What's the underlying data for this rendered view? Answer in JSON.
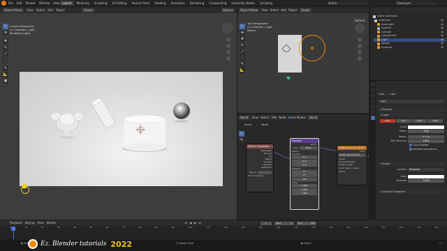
{
  "topbar": {
    "menus": [
      "File",
      "Edit",
      "Render",
      "Window",
      "Help"
    ],
    "workspace_tabs": [
      "Layout",
      "Modeling",
      "Sculpting",
      "UV Editing",
      "Texture Paint",
      "Shading",
      "Animation",
      "Rendering",
      "Compositing",
      "Geometry Nodes",
      "Scripting"
    ],
    "active_tab": "Layout",
    "scene_name": "Scene",
    "view_layer": "ViewLayer"
  },
  "viewport_left": {
    "mode": "Object Mode",
    "menus": [
      "View",
      "Select",
      "Add",
      "Object"
    ],
    "transform": "Global",
    "info_line1": "Camera Perspective",
    "info_line2": "(1) Collection | Light",
    "info_line3": "Rendering Lights",
    "options_label": "Options"
  },
  "viewport_right": {
    "mode": "Object Mode",
    "menus": [
      "View",
      "Select",
      "Add",
      "Object"
    ],
    "transform": "Global",
    "info_line1": "Top Orthographic",
    "info_line2": "(1) Collection | Light",
    "info_line3": "Meters",
    "options_label": "Options"
  },
  "node_editor": {
    "world_label": "World",
    "menus": [
      "View",
      "Select",
      "Add",
      "Node"
    ],
    "use_nodes_label": "Use Nodes",
    "slot_label": "World",
    "breadcrumb": [
      "Scene",
      "World"
    ],
    "nodes": {
      "texcoord": {
        "title": "Texture Coordinate",
        "outputs": [
          "Generated",
          "Normal",
          "UV",
          "Object",
          "Camera",
          "Window",
          "Reflection"
        ],
        "object_label": "Object",
        "from_instancer": "From Instancer"
      },
      "mapping": {
        "title": "Mapping",
        "outputs": [
          "Vector"
        ],
        "type_label": "Type",
        "type_value": "Point",
        "inputs": [
          "Vector",
          "Location"
        ],
        "loc_vals": [
          "0 m",
          "0 m",
          "0 m"
        ],
        "rotation_label": "Rotation",
        "rot_vals": [
          "0°",
          "0°",
          "-90°"
        ],
        "scale_label": "Scale",
        "scale_vals": [
          "1.000",
          "1.000",
          "1.000"
        ]
      },
      "envtex": {
        "title": "studio_small_03_4k.exr",
        "outputs": [
          "Color"
        ],
        "file": "studio_small_03_4k",
        "linear": "Linear",
        "projection": "Equirectangular",
        "extension": "Single Image",
        "colorspace_label": "Color Space",
        "colorspace_value": "Linear",
        "vector_label": "Vector"
      }
    }
  },
  "outliner": {
    "header_label": "Scene Collection",
    "items": [
      {
        "name": "Collection",
        "color": "#cccccc"
      },
      {
        "name": "Area.Light",
        "color": "#e3a13b"
      },
      {
        "name": "Camera",
        "color": "#9fb8d6"
      },
      {
        "name": "Cylinder",
        "color": "#e3a13b"
      },
      {
        "name": "Cylinder.001",
        "color": "#e3a13b"
      },
      {
        "name": "Light",
        "color": "#e3a13b"
      },
      {
        "name": "Sphere",
        "color": "#e3a13b"
      },
      {
        "name": "Suzanne",
        "color": "#e3a13b"
      }
    ],
    "selected_index": 5
  },
  "properties": {
    "breadcrumb": [
      "Light",
      "Light"
    ],
    "name_field": "Light",
    "preview_label": "Preview",
    "section_light": "Light",
    "light_types": [
      "Point",
      "Sun",
      "Spot",
      "Area"
    ],
    "active_type": "Point",
    "color_label": "Color",
    "power_label": "Power",
    "power_value": "0 W",
    "radius_label": "Radius",
    "radius_value": "0.1 m",
    "max_bounces_label": "Max Bounces",
    "max_bounces_value": "1024",
    "cast_shadow": "Cast Shadow",
    "multiple_importance": "Multiple Importance",
    "nodes_section": "Nodes",
    "surface_label": "Surface",
    "surface_value": "Emission",
    "node_color_label": "Color",
    "strength_label": "Strength",
    "strength_value": "1.000",
    "custom_props": "Custom Properties"
  },
  "timeline": {
    "playback": "Playback",
    "keying": "Keying",
    "menus": [
      "View",
      "Marker"
    ],
    "current_frame": "1",
    "start_label": "Start",
    "start_value": "1",
    "end_label": "End",
    "end_value": "250",
    "ticks": [
      "0",
      "10",
      "20",
      "30",
      "40",
      "50",
      "60",
      "70",
      "80",
      "90",
      "100",
      "110",
      "120",
      "130",
      "140",
      "150",
      "160",
      "170",
      "180",
      "190",
      "200",
      "210",
      "220",
      "230",
      "240",
      "250"
    ]
  },
  "statusbar": {
    "left_hint": "Box Select",
    "mid_hint": "Rotate View",
    "right_hint": "Object",
    "version": "3.1"
  },
  "watermark": {
    "text": "Ez. Blender tutorials",
    "year": "2022"
  }
}
